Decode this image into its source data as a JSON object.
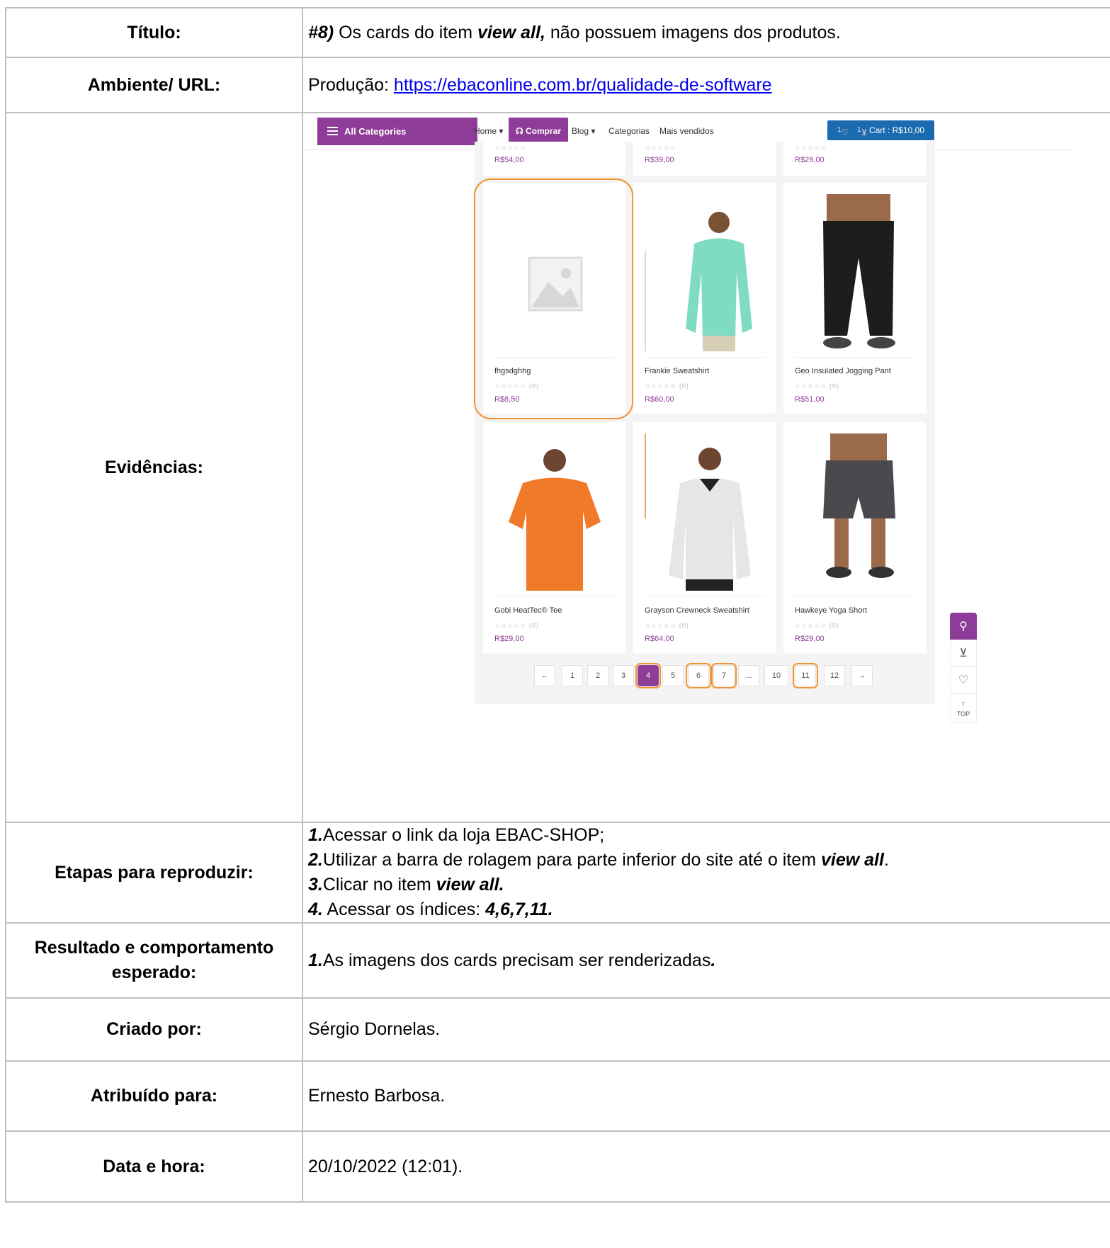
{
  "report": {
    "titulo_label": "Título:",
    "titulo_prefix": "#8)",
    "titulo_text1": " Os cards do item ",
    "titulo_em": "view all,",
    "titulo_text2": " não possuem imagens dos produtos.",
    "ambiente_label": "Ambiente/ URL:",
    "ambiente_prefix": "Produção: ",
    "ambiente_url": "https://ebaconline.com.br/qualidade-de-software",
    "evidencias_label": "Evidências:",
    "etapas_label": "Etapas para reproduzir:",
    "etapas": [
      {
        "num": "1.",
        "text": "Acessar o link da loja EBAC-SHOP;",
        "em": "",
        "tail": ""
      },
      {
        "num": "2.",
        "text": "Utilizar a barra de rolagem para parte inferior do site até o item ",
        "em": "view all",
        "tail": "."
      },
      {
        "num": "3.",
        "text": "Clicar no item ",
        "em": "view all.",
        "tail": ""
      },
      {
        "num": "4.",
        "text": " Acessar os índices: ",
        "em": "4,6,7,11.",
        "tail": ""
      }
    ],
    "resultado_label": "Resultado e comportamento esperado:",
    "resultado_num": "1.",
    "resultado_text": "As imagens dos cards precisam ser renderizadas",
    "resultado_tail": ".",
    "criado_label": "Criado por:",
    "criado_value": "Sérgio Dornelas.",
    "atribuido_label": "Atribuído para:",
    "atribuido_value": "Ernesto Barbosa.",
    "data_label": "Data e hora:",
    "data_value": " 20/10/2022 (12:01)."
  },
  "shop": {
    "all_categories": "All Categories",
    "nav": [
      "Home ▾",
      "Comprar",
      "Blog ▾",
      "Categorias",
      "Mais vendidos"
    ],
    "cart_label": "Cart : R$10,00",
    "wishlist_count": "1",
    "cart_count": "1",
    "top_prices": [
      "R$54,00",
      "R$39,00",
      "R$29,00"
    ],
    "products": [
      {
        "name": "fhgsdghhg",
        "rating": "☆☆☆☆☆ (0)",
        "price": "R$8,50"
      },
      {
        "name": "Frankie Sweatshirt",
        "rating": "☆☆☆☆☆ (0)",
        "price": "R$60,00"
      },
      {
        "name": "Geo Insulated Jogging Pant",
        "rating": "☆☆☆☆☆ (0)",
        "price": "R$51,00"
      },
      {
        "name": "Gobi HeatTec® Tee",
        "rating": "☆☆☆☆☆ (0)",
        "price": "R$29,00"
      },
      {
        "name": "Grayson Crewneck Sweatshirt",
        "rating": "☆☆☆☆☆ (0)",
        "price": "R$64,00"
      },
      {
        "name": "Hawkeye Yoga Short",
        "rating": "☆☆☆☆☆ (0)",
        "price": "R$29,00"
      }
    ],
    "pagination": [
      "←",
      "1",
      "2",
      "3",
      "4",
      "5",
      "6",
      "7",
      "...",
      "10",
      "11",
      "12",
      "→"
    ],
    "current_page": "4",
    "top_label": "TOP",
    "colors": {
      "brand": "#8d3c97",
      "cart": "#1b6bb0",
      "highlight": "#f39433"
    }
  }
}
